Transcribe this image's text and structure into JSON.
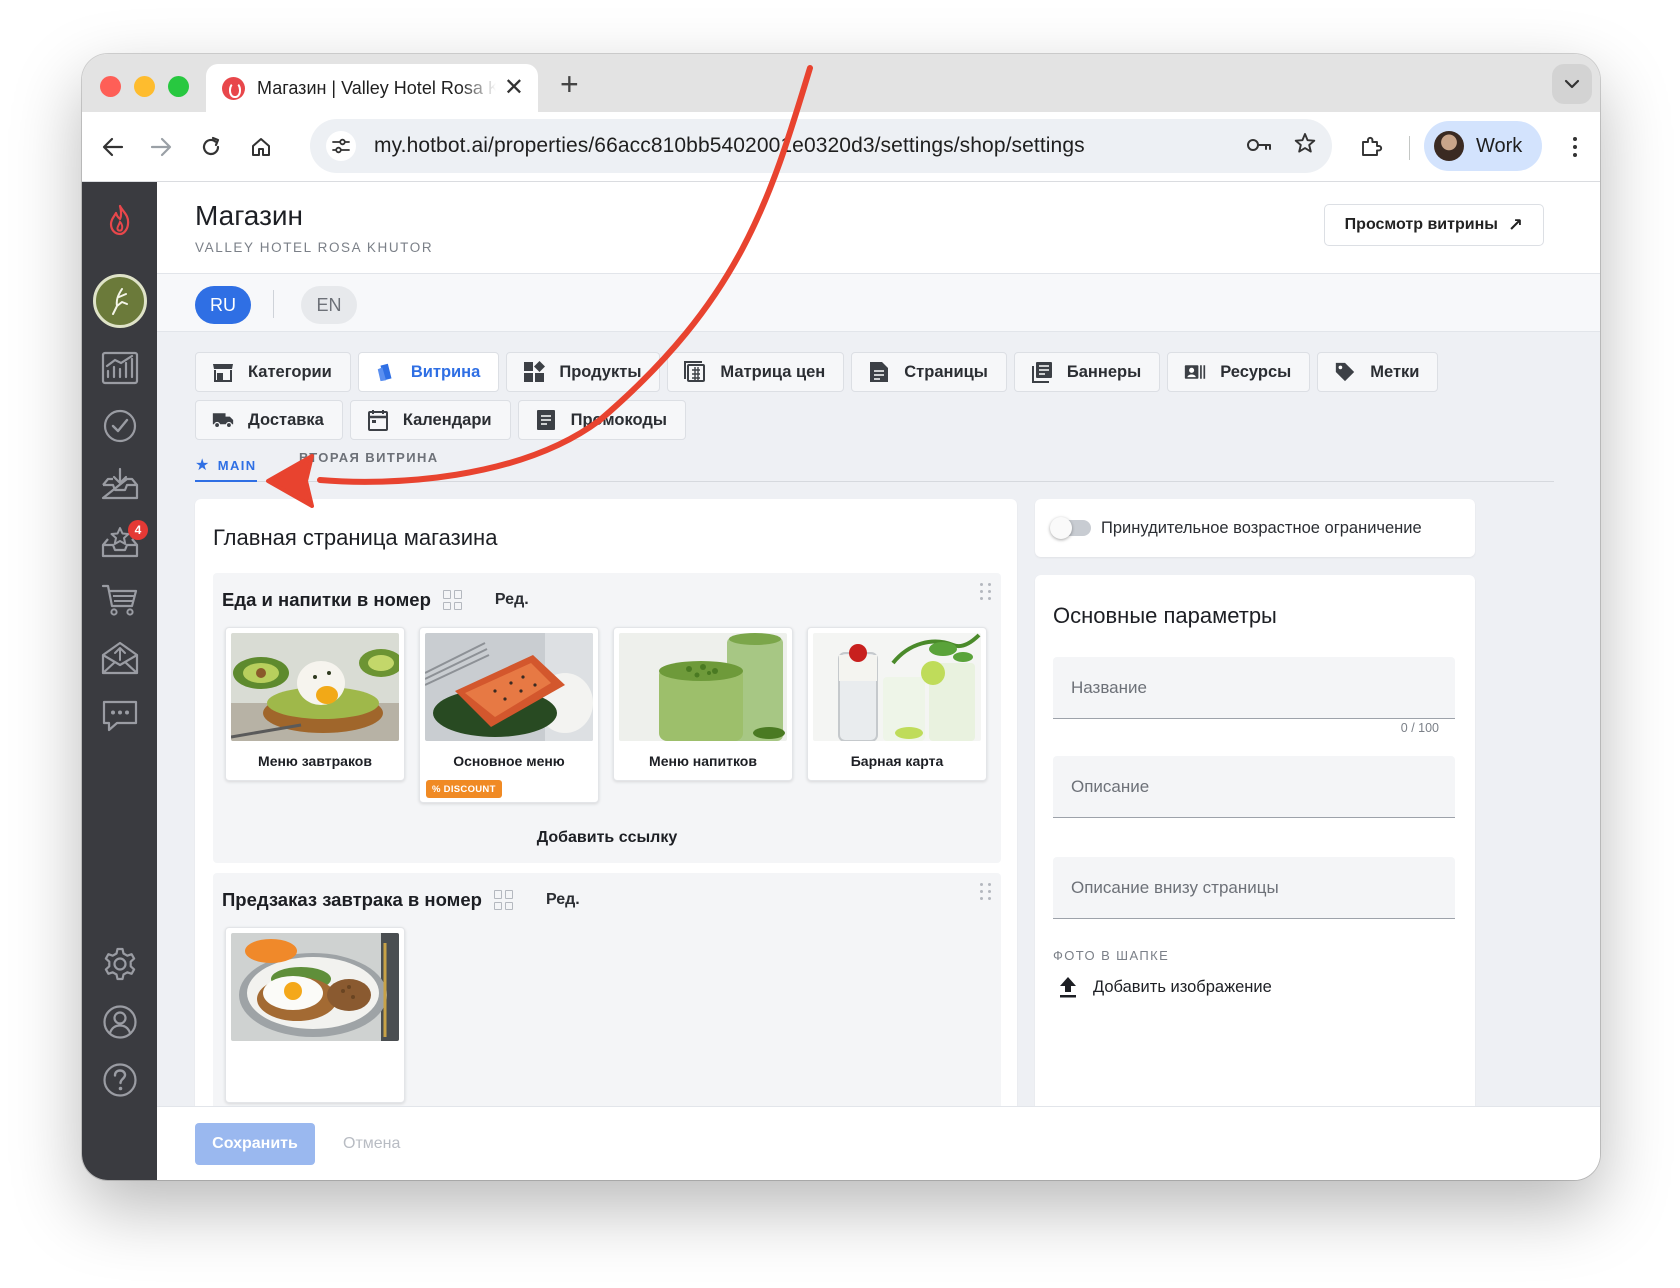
{
  "browser": {
    "tab_title": "Магазин | Valley Hotel Rosa Khutor",
    "close_glyph": "✕",
    "new_tab_glyph": "+",
    "url": "my.hotbot.ai/properties/66acc810bb54020​01e0320d3/settings/shop/settings",
    "profile_name": "Work"
  },
  "rail": {
    "notification_count": "4"
  },
  "header": {
    "title": "Магазин",
    "subtitle": "VALLEY HOTEL ROSA KHUTOR",
    "view_button": "Просмотр витрины",
    "view_button_arrow": "↗"
  },
  "languages": {
    "active": "RU",
    "other": "EN"
  },
  "nav_tabs": [
    {
      "label": "Категории"
    },
    {
      "label": "Витрина"
    },
    {
      "label": "Продукты"
    },
    {
      "label": "Матрица цен"
    },
    {
      "label": "Страницы"
    },
    {
      "label": "Баннеры"
    },
    {
      "label": "Ресурсы"
    },
    {
      "label": "Метки"
    },
    {
      "label": "Доставка"
    },
    {
      "label": "Календари"
    },
    {
      "label": "Промокоды"
    }
  ],
  "subtabs": {
    "active_star": "★",
    "active": "MAIN",
    "other": "ВТОРАЯ ВИТРИНА"
  },
  "storefront": {
    "title": "Главная страница магазина",
    "sections": [
      {
        "title": "Еда и напитки в номер",
        "edit_label": "Ред.",
        "add_link": "Добавить ссылку",
        "items": [
          {
            "label": "Меню завтраков"
          },
          {
            "label": "Основное меню",
            "badge": "% DISCOUNT"
          },
          {
            "label": "Меню напитков"
          },
          {
            "label": "Барная карта"
          }
        ]
      },
      {
        "title": "Предзаказ завтрака в номер",
        "edit_label": "Ред."
      }
    ]
  },
  "age_restriction": {
    "label": "Принудительное возрастное ограничение",
    "enabled": false
  },
  "params": {
    "title": "Основные параметры",
    "name_placeholder": "Название",
    "name_counter": "0 / 100",
    "description_placeholder": "Описание",
    "footer_description_placeholder": "Описание внизу страницы",
    "header_photo_label": "ФОТО В ШАПКЕ",
    "add_image": "Добавить изображение"
  },
  "footer": {
    "save": "Сохранить",
    "cancel": "Отмена"
  },
  "colors": {
    "accent": "#2f6fe4",
    "rail": "#3a3b40",
    "annotation_arrow": "#e8432f",
    "badge": "#f08a24"
  }
}
